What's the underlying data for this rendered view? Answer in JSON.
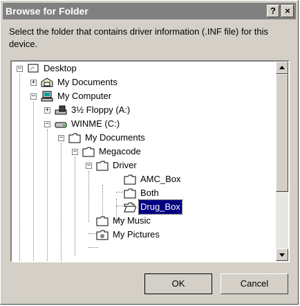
{
  "window": {
    "title": "Browse for Folder",
    "help_glyph": "?",
    "close_glyph": "×"
  },
  "description": "Select the folder that contains driver information (.INF file) for this device.",
  "tree": {
    "items": [
      {
        "label": "Desktop",
        "icon": "desktop-icon",
        "expander": "−"
      },
      {
        "label": "My Documents",
        "icon": "my-documents-icon",
        "expander": "+"
      },
      {
        "label": "My Computer",
        "icon": "computer-icon",
        "expander": "−"
      },
      {
        "label": "3½ Floppy (A:)",
        "icon": "floppy-drive-icon",
        "expander": "+"
      },
      {
        "label": "WINME (C:)",
        "icon": "hard-drive-icon",
        "expander": "−"
      },
      {
        "label": "My Documents",
        "icon": "folder-icon",
        "expander": "−"
      },
      {
        "label": "Megacode",
        "icon": "folder-icon",
        "expander": "−"
      },
      {
        "label": "Driver",
        "icon": "folder-icon",
        "expander": "−"
      },
      {
        "label": "AMC_Box",
        "icon": "folder-icon",
        "expander": ""
      },
      {
        "label": "Both",
        "icon": "folder-icon",
        "expander": ""
      },
      {
        "label": "Drug_Box",
        "icon": "open-folder-icon",
        "expander": "",
        "selected": true
      },
      {
        "label": "My Music",
        "icon": "folder-icon",
        "expander": ""
      },
      {
        "label": "My Pictures",
        "icon": "pictures-folder-icon",
        "expander": ""
      }
    ]
  },
  "buttons": {
    "ok": "OK",
    "cancel": "Cancel"
  },
  "colors": {
    "titlebar_inactive": "#808080",
    "dialog_face": "#d4d0c8",
    "selection": "#000080"
  }
}
